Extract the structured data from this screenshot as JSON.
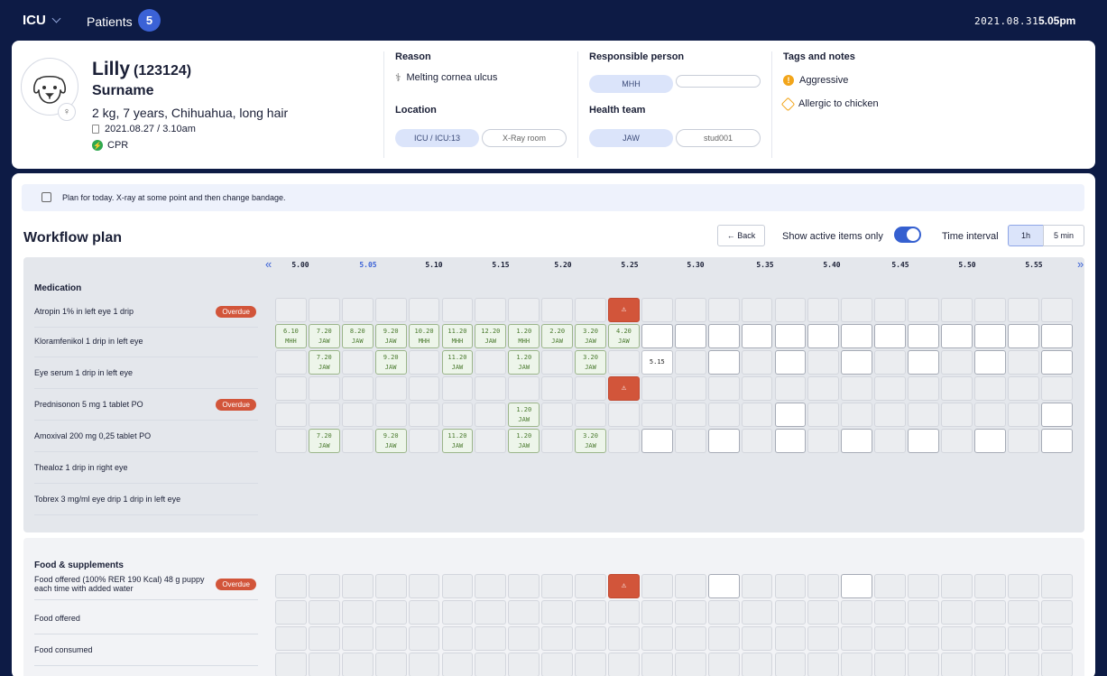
{
  "topbar": {
    "unit": "ICU",
    "patients_label": "Patients",
    "patients_count": "5",
    "date": "2021.08.31",
    "time": "5.05pm"
  },
  "patient": {
    "name": "Lilly",
    "id": "(123124)",
    "surname": "Surname",
    "info": "2 kg, 7 years, Chihuahua, long hair",
    "admitted": "2021.08.27 / 3.10am",
    "cpr": "CPR"
  },
  "reason": {
    "heading": "Reason",
    "value": "Melting cornea ulcus"
  },
  "location": {
    "heading": "Location",
    "values": [
      "ICU / ICU:13",
      "X-Ray room"
    ]
  },
  "responsible": {
    "heading": "Responsible person",
    "value": "MHH"
  },
  "team": {
    "heading": "Health team",
    "values": [
      "JAW",
      "stud001"
    ]
  },
  "tags": {
    "heading": "Tags and notes",
    "items": [
      "Aggressive",
      "Allergic to chicken"
    ]
  },
  "note": "Plan for today. X-ray at some point and then change bandage.",
  "workflow": {
    "title": "Workflow plan",
    "back": "← Back",
    "active_label": "Show active items only",
    "active_on": true,
    "interval_label": "Time interval",
    "interval_options": [
      "1h",
      "5 min"
    ],
    "interval_selected": "1h"
  },
  "timeline": {
    "headers": [
      "5.00",
      "5.05",
      "5.10",
      "5.15",
      "5.20",
      "5.25",
      "5.30",
      "5.35",
      "5.40",
      "5.45",
      "5.50",
      "5.55"
    ],
    "current": "5.05",
    "prev": "«",
    "next": "»"
  },
  "overdue_label": "Overdue",
  "sections": [
    {
      "title": "Medication",
      "rows": [
        {
          "label": "Atropin 1% in left eye 1 drip",
          "overdue": true,
          "cells": [
            "",
            "",
            "",
            "",
            "",
            "",
            "",
            "",
            "",
            "",
            "r"
          ]
        },
        {
          "label": "Kloramfenikol 1 drip in left eye",
          "overdue": false,
          "cells": [
            "6.10|MHH",
            "7.20|JAW",
            "8.20|JAW",
            "9.20|JAW",
            "10.20|MHH",
            "11.20|MHH",
            "12.20|JAW",
            "1.20|MHH",
            "2.20|JAW",
            "3.20|JAW",
            "4.20|JAW",
            "w",
            "w",
            "w",
            "w",
            "w",
            "w",
            "w",
            "w",
            "w",
            "w",
            "w",
            "w",
            "w"
          ]
        },
        {
          "label": "Eye serum 1 drip in left eye",
          "overdue": false,
          "cells": [
            "",
            "7.20|JAW",
            "",
            "9.20|JAW",
            "",
            "11.20|JAW",
            "",
            "1.20|JAW",
            "",
            "3.20|JAW",
            "",
            "t:5.15",
            "",
            "w",
            "",
            "w",
            "",
            "w",
            "",
            "w",
            "",
            "w",
            "",
            "w"
          ]
        },
        {
          "label": "Prednisonon 5 mg 1 tablet PO",
          "overdue": true,
          "cells": [
            "",
            "",
            "",
            "",
            "",
            "",
            "",
            "",
            "",
            "",
            "r"
          ]
        },
        {
          "label": "Amoxival 200 mg 0,25 tablet PO",
          "overdue": false,
          "cells": [
            "",
            "",
            "",
            "",
            "",
            "",
            "",
            "1.20|JAW",
            "",
            "",
            "",
            "",
            "",
            "",
            "",
            "w",
            "",
            "",
            "",
            "",
            "",
            "",
            "",
            "w"
          ]
        },
        {
          "label": "Thealoz 1 drip in right eye",
          "overdue": false,
          "cells": [
            "",
            "",
            "",
            "9.20|JAW",
            "",
            "",
            "",
            "1.20|JAW",
            "",
            "",
            "",
            "w",
            "",
            "",
            "",
            "w",
            "",
            "",
            "",
            "w",
            "",
            "",
            "",
            "w"
          ]
        },
        {
          "label": "Tobrex 3 mg/ml eye drip 1 drip in left eye",
          "overdue": false,
          "cells": [
            "",
            "7.20|JAW",
            "",
            "9.20|JAW",
            "",
            "11.20|JAW",
            "",
            "1.20|JAW",
            "",
            "3.20|JAW",
            "",
            "w",
            "",
            "w",
            "",
            "w",
            "",
            "w",
            "",
            "w",
            "",
            "w",
            "",
            "w"
          ]
        }
      ]
    },
    {
      "title": "Food & supplements",
      "rows": [
        {
          "label": "Food offered (100% RER 190 Kcal) 48 g puppy each time with added water",
          "overdue": true,
          "cells": [
            "",
            "",
            "",
            "",
            "",
            "",
            "",
            "",
            "",
            "",
            "r",
            "",
            "",
            "w",
            "",
            "",
            "",
            "w"
          ]
        },
        {
          "label": "Food offered",
          "overdue": false,
          "cells": []
        },
        {
          "label": "Food consumed",
          "overdue": false,
          "cells": []
        }
      ]
    }
  ]
}
